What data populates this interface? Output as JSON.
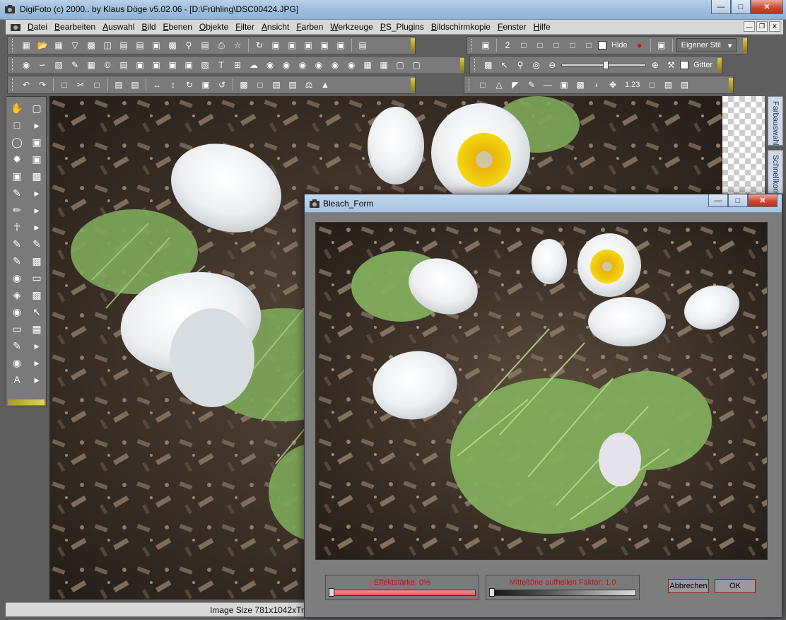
{
  "window": {
    "title": "DigiFoto (c) 2000.. by Klaus Döge v5.02.06 - [D:\\Frühling\\DSC00424.JPG]"
  },
  "menu": [
    "Datei",
    "Bearbeiten",
    "Auswahl",
    "Bild",
    "Ebenen",
    "Objekte",
    "Filter",
    "Ansicht",
    "Farben",
    "Werkzeuge",
    "PS_Plugins",
    "Bildschirmkopie",
    "Fenster",
    "Hilfe"
  ],
  "toolbar": {
    "hide_label": "Hide",
    "style_select": "Eigener Stil",
    "grid_label": "Gitter",
    "num_label": "1.23"
  },
  "side_tabs": {
    "color_tab": "Farbauswahl",
    "quick_tab": "Schnellkorr"
  },
  "status": {
    "image_size": "Image Size 781x1042xTr"
  },
  "dialog": {
    "title": "Bleach_Form",
    "effect_label": "Effektstärke: 0%",
    "effect_value": 0,
    "midtone_label": "Mitteltöne aufhellen Faktor: 1.0",
    "midtone_value": 1.0,
    "cancel_label": "Abbrechen",
    "ok_label": "OK"
  },
  "colors": {
    "title_blue": "#a7c2df",
    "close_red": "#c9452f",
    "label_red": "#b81818",
    "effect_fill": "#e88080"
  }
}
